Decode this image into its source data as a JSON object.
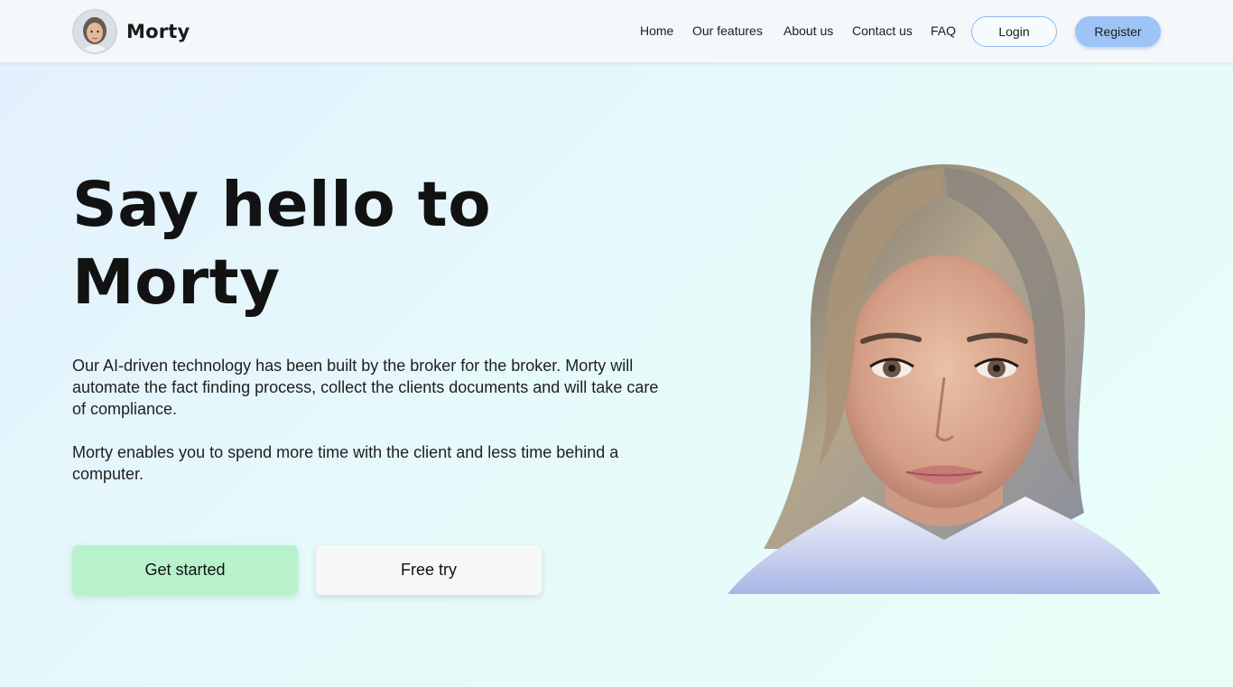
{
  "brand": {
    "name": "Morty",
    "logo_icon": "avatar-portrait-icon"
  },
  "nav": {
    "items": [
      {
        "label": "Home"
      },
      {
        "label": "Our features"
      },
      {
        "label": "About us"
      },
      {
        "label": "Contact us"
      },
      {
        "label": "FAQ"
      }
    ],
    "login_label": "Login",
    "register_label": "Register"
  },
  "hero": {
    "title_line1": "Say hello to",
    "title_line2": "Morty",
    "paragraph1": "Our AI-driven technology has been built by the broker for the broker. Morty will automate the fact finding process, collect the clients documents and will take care of compliance.",
    "paragraph2": "Morty enables you to spend more time with the client and less time behind a computer.",
    "primary_cta": "Get started",
    "secondary_cta": "Free try",
    "image_icon": "woman-portrait-icon"
  },
  "colors": {
    "register_bg": "#9ec3f5",
    "login_border": "#8fb8ec",
    "primary_cta_bg": "#b8f2cc",
    "secondary_cta_bg": "#f7f7f7"
  }
}
